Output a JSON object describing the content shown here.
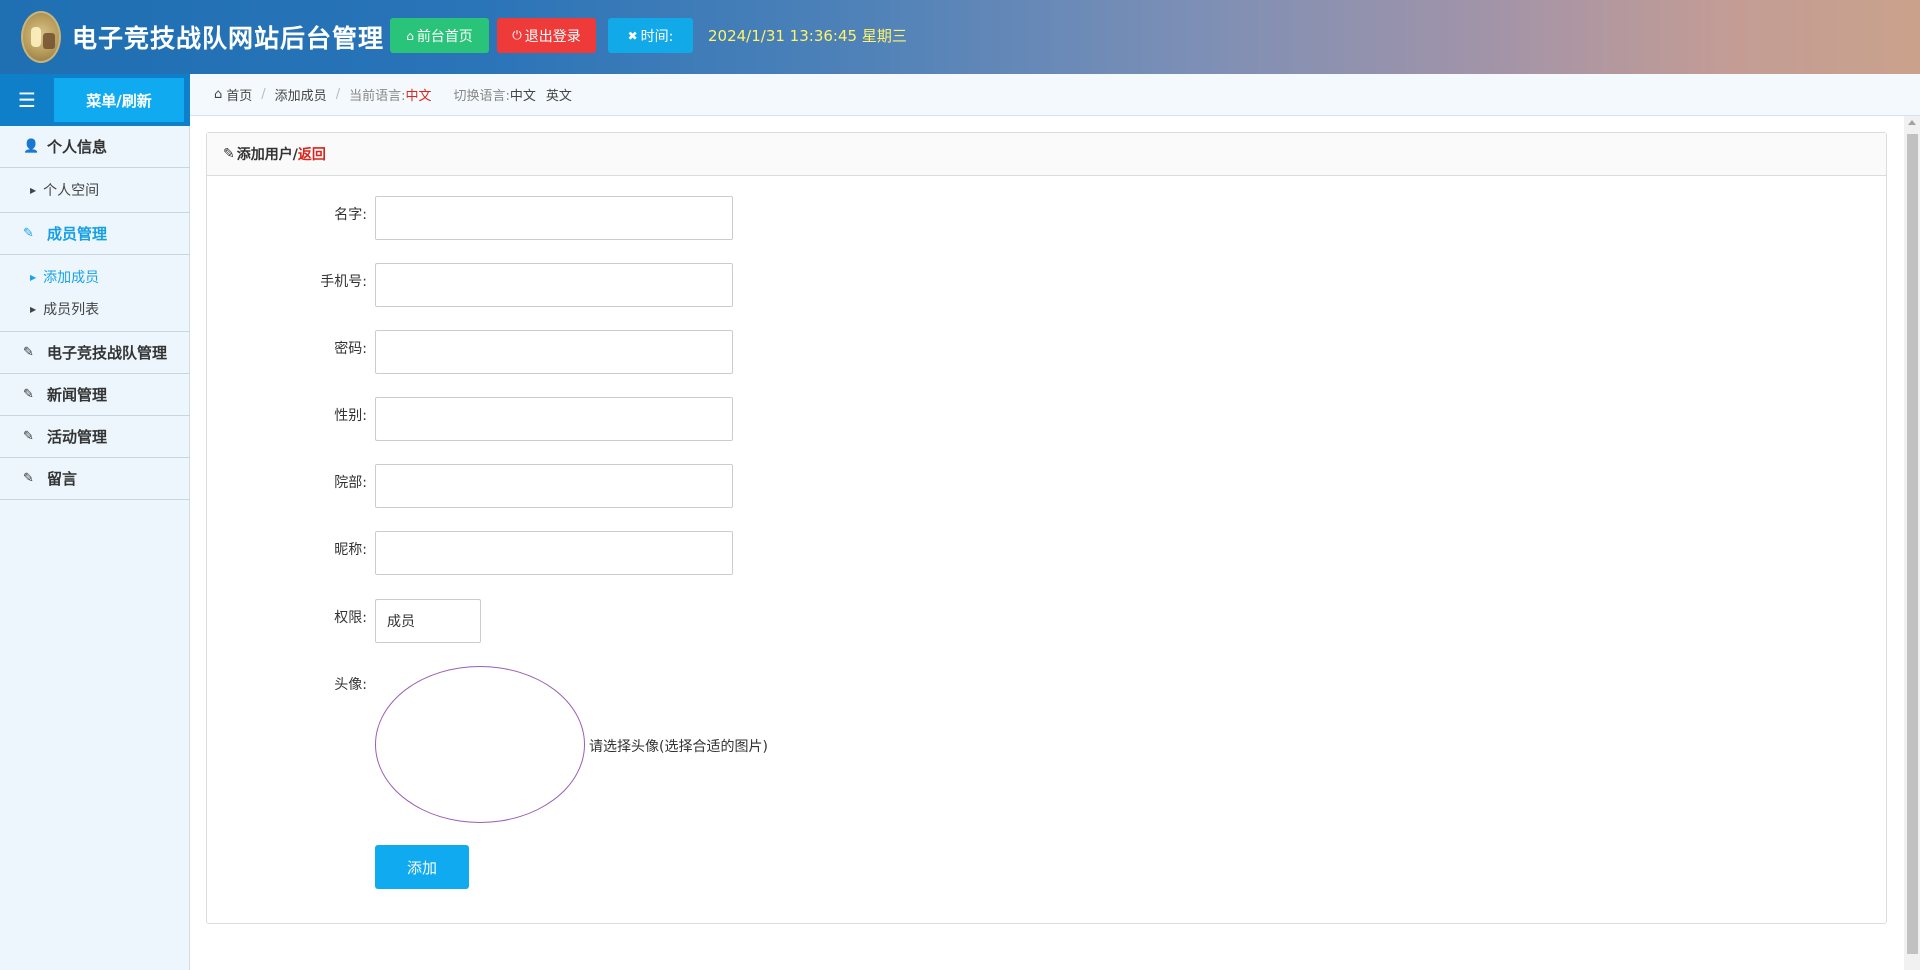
{
  "header": {
    "site_title": "电子竞技战队网站后台管理",
    "home_button": "前台首页",
    "logout_button": "退出登录",
    "time_button": "时间:",
    "clock": "2024/1/31 13:36:45 星期三"
  },
  "sidebar": {
    "refresh_label": "菜单/刷新",
    "groups": [
      {
        "label": "个人信息",
        "items": [
          {
            "label": "个人空间"
          }
        ]
      },
      {
        "label": "成员管理",
        "items": [
          {
            "label": "添加成员"
          },
          {
            "label": "成员列表"
          }
        ]
      },
      {
        "label": "电子竞技战队管理"
      },
      {
        "label": "新闻管理"
      },
      {
        "label": "活动管理"
      },
      {
        "label": "留言"
      }
    ]
  },
  "breadcrumb": {
    "home": "首页",
    "current": "添加成员",
    "lang_label": "当前语言:",
    "lang_value": "中文",
    "switch_label": "切换语言:",
    "lang_zh": "中文",
    "lang_en": "英文"
  },
  "form": {
    "title": "添加用户/",
    "back_link": "返回",
    "fields": [
      {
        "label": "名字:",
        "value": ""
      },
      {
        "label": "手机号:",
        "value": ""
      },
      {
        "label": "密码:",
        "value": ""
      },
      {
        "label": "性别:",
        "value": ""
      },
      {
        "label": "院部:",
        "value": ""
      },
      {
        "label": "昵称:",
        "value": ""
      }
    ],
    "permission_label": "权限:",
    "permission_value": "成员",
    "avatar_label": "头像:",
    "avatar_hint": "请选择头像(选择合适的图片)",
    "submit": "添加"
  }
}
